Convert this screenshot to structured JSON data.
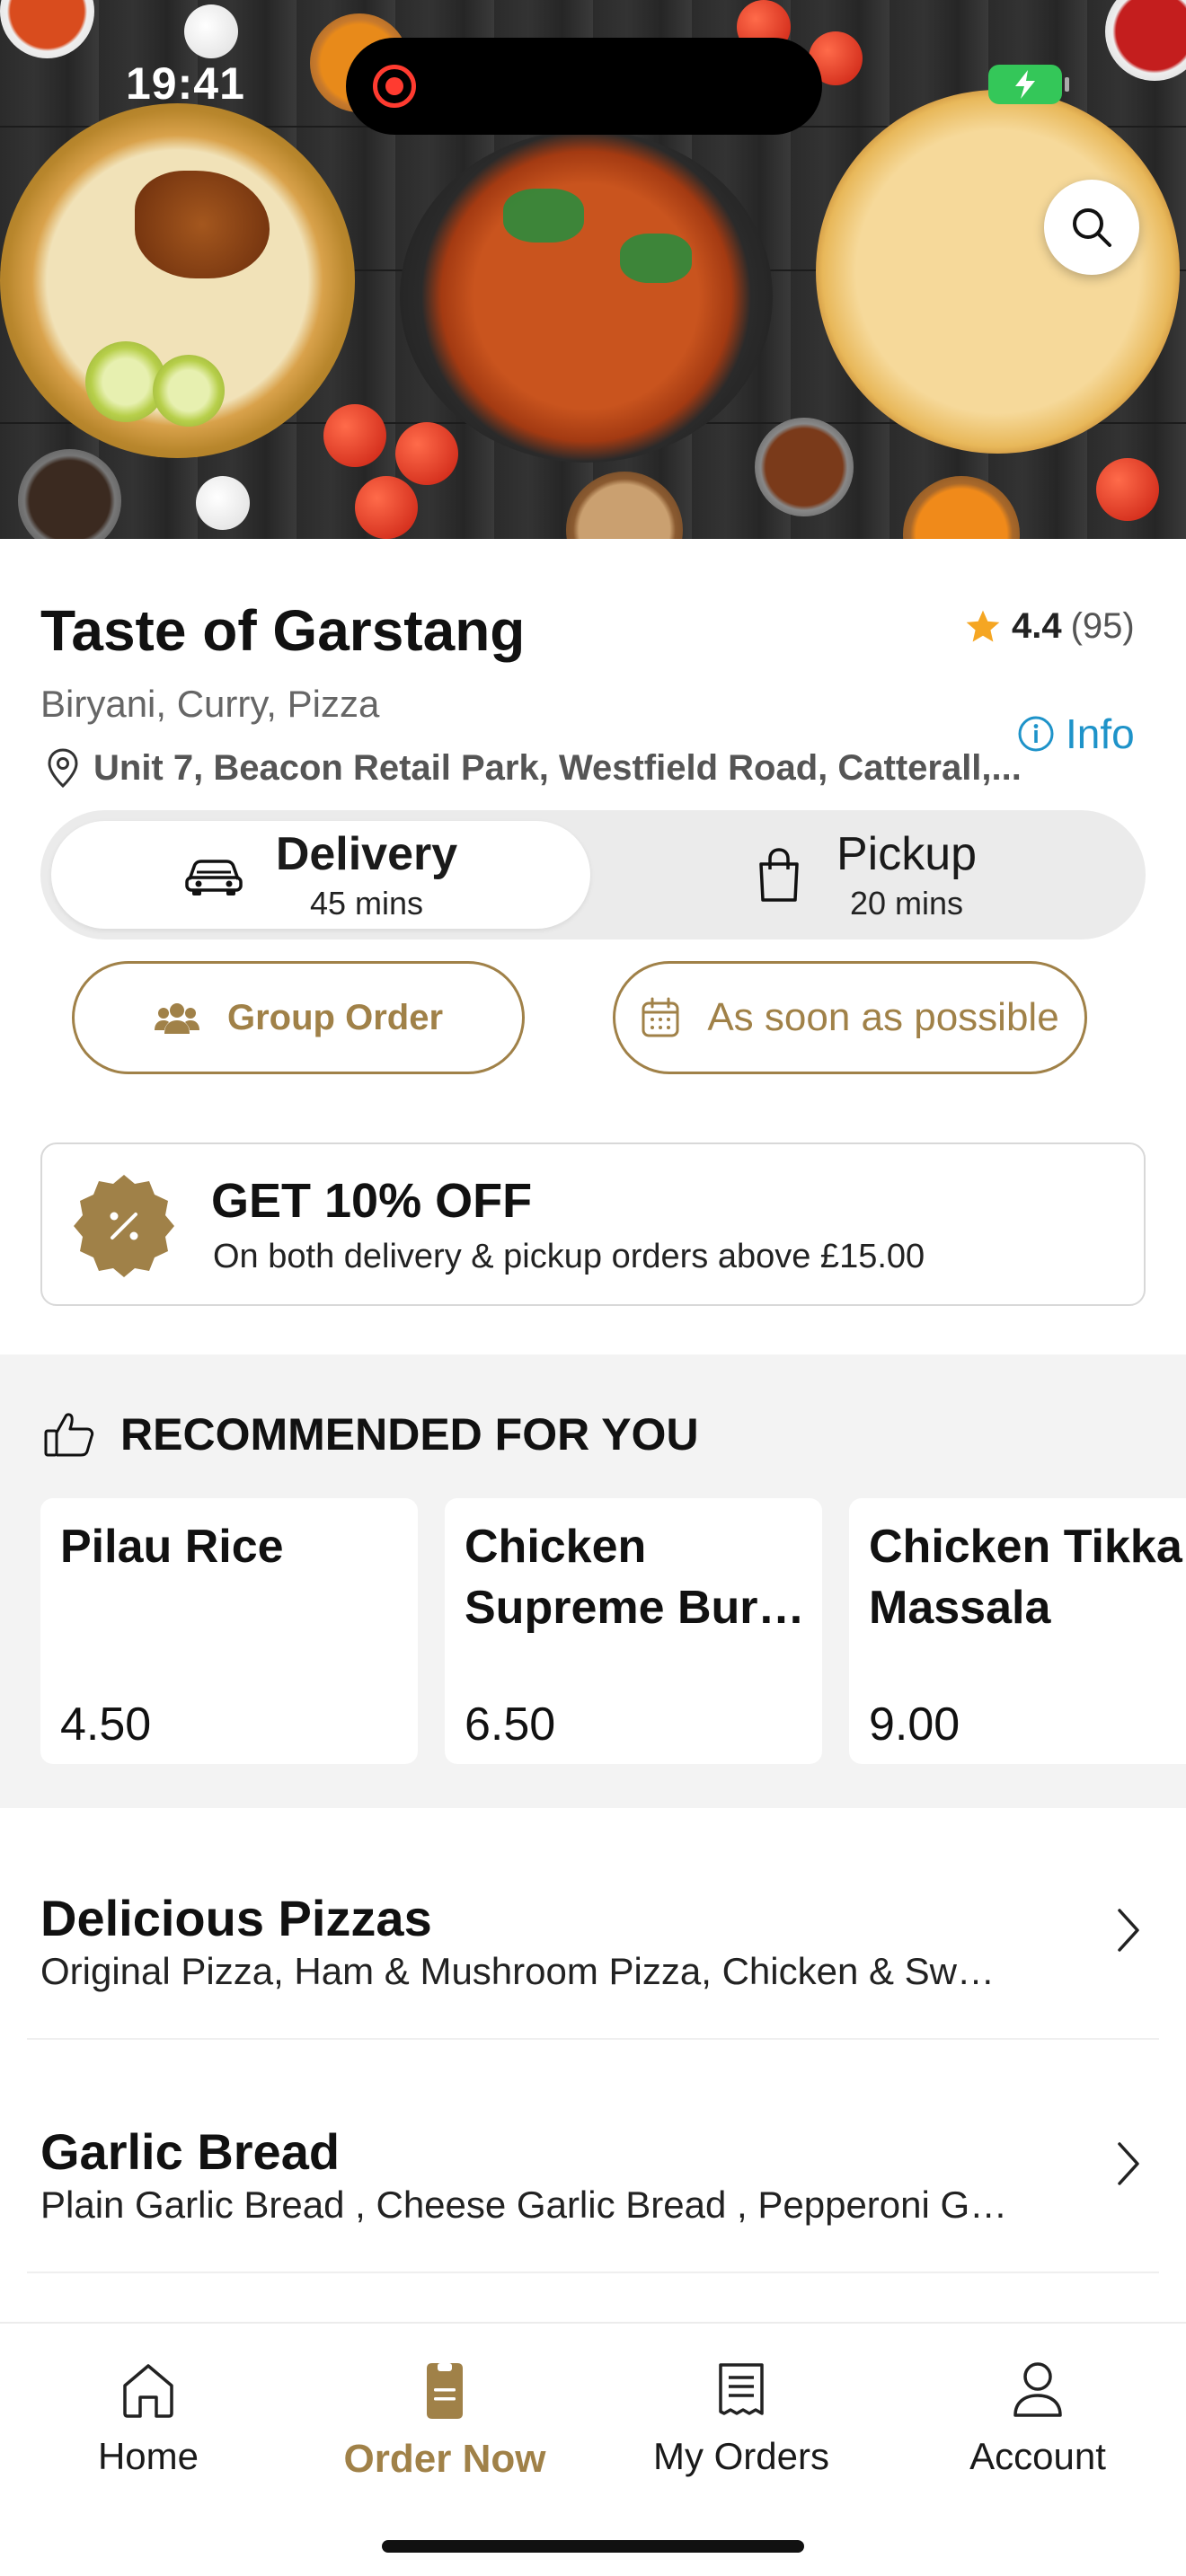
{
  "status_bar": {
    "time": "19:41"
  },
  "restaurant": {
    "name": "Taste of Garstang",
    "rating": "4.4",
    "rating_count": "(95)",
    "cuisines": "Biryani, Curry, Pizza",
    "info_label": "Info",
    "address": "Unit 7, Beacon Retail Park, Westfield Road, Catterall,..."
  },
  "order_modes": {
    "delivery": {
      "label": "Delivery",
      "time": "45 mins"
    },
    "pickup": {
      "label": "Pickup",
      "time": "20 mins"
    }
  },
  "actions": {
    "group_order": "Group Order",
    "schedule": "As soon as possible"
  },
  "offer": {
    "title": "GET 10% OFF",
    "subtitle": "On both delivery & pickup orders above £15.00"
  },
  "recommended": {
    "title": "RECOMMENDED FOR YOU",
    "items": [
      {
        "name": "Pilau Rice",
        "price": "4.50"
      },
      {
        "name": "Chicken Supreme Bur…",
        "price": "6.50"
      },
      {
        "name": "Chicken Tikka Massala",
        "price": "9.00"
      }
    ]
  },
  "categories": [
    {
      "title": "Delicious Pizzas",
      "items": "Original Pizza, Ham & Mushroom Pizza, Chicken & Sw…"
    },
    {
      "title": "Garlic Bread",
      "items": "Plain Garlic Bread , Cheese Garlic Bread , Pepperoni G…"
    }
  ],
  "tabbar": [
    {
      "label": "Home",
      "icon": "home-icon"
    },
    {
      "label": "Order Now",
      "icon": "order-icon"
    },
    {
      "label": "My Orders",
      "icon": "receipt-icon"
    },
    {
      "label": "Account",
      "icon": "user-icon"
    }
  ],
  "colors": {
    "accent": "#a08148",
    "info": "#1e93c9",
    "star": "#f5a623",
    "battery": "#34c759"
  }
}
